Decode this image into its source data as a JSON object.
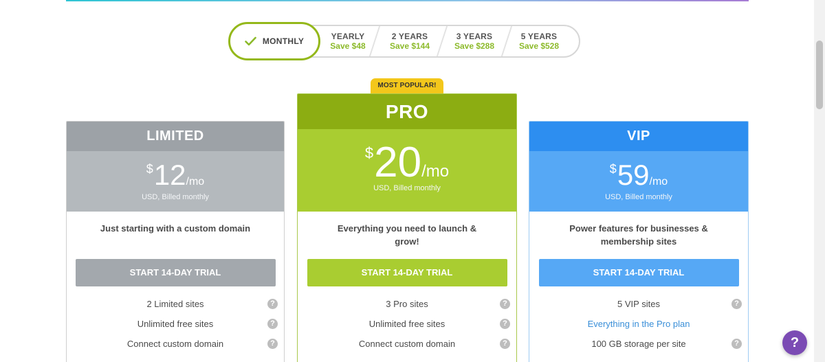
{
  "billing": {
    "active_label": "MONTHLY",
    "options": [
      {
        "label": "YEARLY",
        "save": "Save $48"
      },
      {
        "label": "2 YEARS",
        "save": "Save $144"
      },
      {
        "label": "3 YEARS",
        "save": "Save $288"
      },
      {
        "label": "5 YEARS",
        "save": "Save $528"
      }
    ]
  },
  "badge": "MOST POPULAR!",
  "plans": [
    {
      "name": "LIMITED",
      "currency": "$",
      "amount": "12",
      "per": "/mo",
      "billed": "USD, Billed monthly",
      "tagline": "Just starting with a custom domain",
      "cta": "START 14-DAY TRIAL",
      "features": [
        "2 Limited sites",
        "Unlimited free sites",
        "Connect custom domain"
      ]
    },
    {
      "name": "PRO",
      "currency": "$",
      "amount": "20",
      "per": "/mo",
      "billed": "USD, Billed monthly",
      "tagline": "Everything you need to launch & grow!",
      "cta": "START 14-DAY TRIAL",
      "features": [
        "3 Pro sites",
        "Unlimited free sites",
        "Connect custom domain"
      ]
    },
    {
      "name": "VIP",
      "currency": "$",
      "amount": "59",
      "per": "/mo",
      "billed": "USD, Billed monthly",
      "tagline": "Power features for businesses & membership sites",
      "cta": "START 14-DAY TRIAL",
      "features": [
        "5 VIP sites",
        "Everything in the Pro plan",
        "100 GB storage per site"
      ]
    }
  ],
  "help_icon_glyph": "?",
  "fab_glyph": "?",
  "colors": {
    "limited": "#9da2a7",
    "pro": "#8cad12",
    "pro_light": "#a9cd31",
    "vip": "#2d8ef0",
    "vip_light": "#56a8f5",
    "badge": "#f3c71b",
    "save_green": "#8cba2a",
    "fab": "#7b4bb4"
  }
}
